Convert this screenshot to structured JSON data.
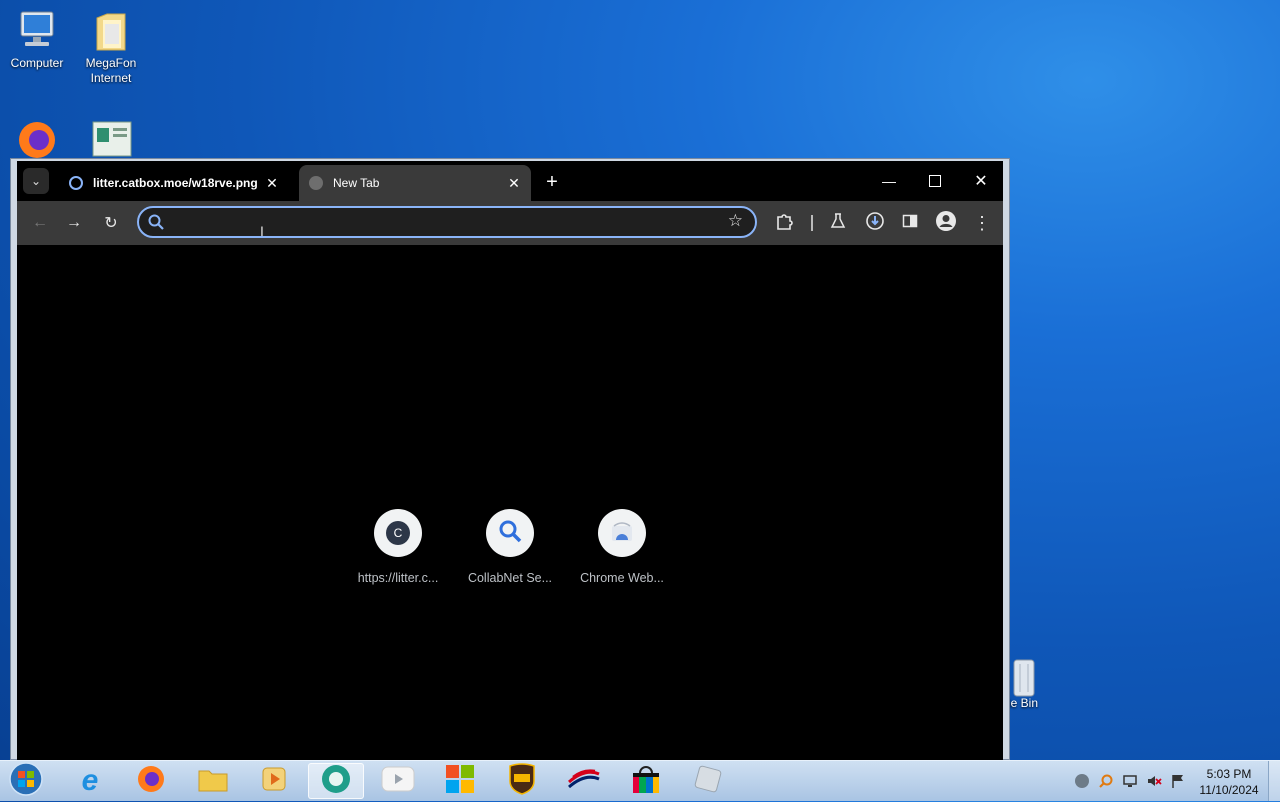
{
  "desktop": {
    "icons": [
      {
        "label": "Computer"
      },
      {
        "label": "MegaFon\nInternet"
      },
      {
        "label": "le Bin"
      }
    ]
  },
  "browser": {
    "tabs": [
      {
        "title": "litter.catbox.moe/w18rve.png",
        "active": false
      },
      {
        "title": "New Tab",
        "active": true
      }
    ],
    "new_tab_glyph": "+",
    "omnibox": {
      "value": "",
      "placeholder": ""
    },
    "shortcuts": [
      {
        "label": "https://litter.c...",
        "letter": "C"
      },
      {
        "label": "CollabNet Se..."
      },
      {
        "label": "Chrome Web..."
      }
    ]
  },
  "taskbar": {
    "clock_time": "5:03 PM",
    "clock_date": "11/10/2024"
  },
  "colors": {
    "accent": "#8ab4f8",
    "tab_active": "#3a3a3a",
    "content_bg": "#000000"
  }
}
